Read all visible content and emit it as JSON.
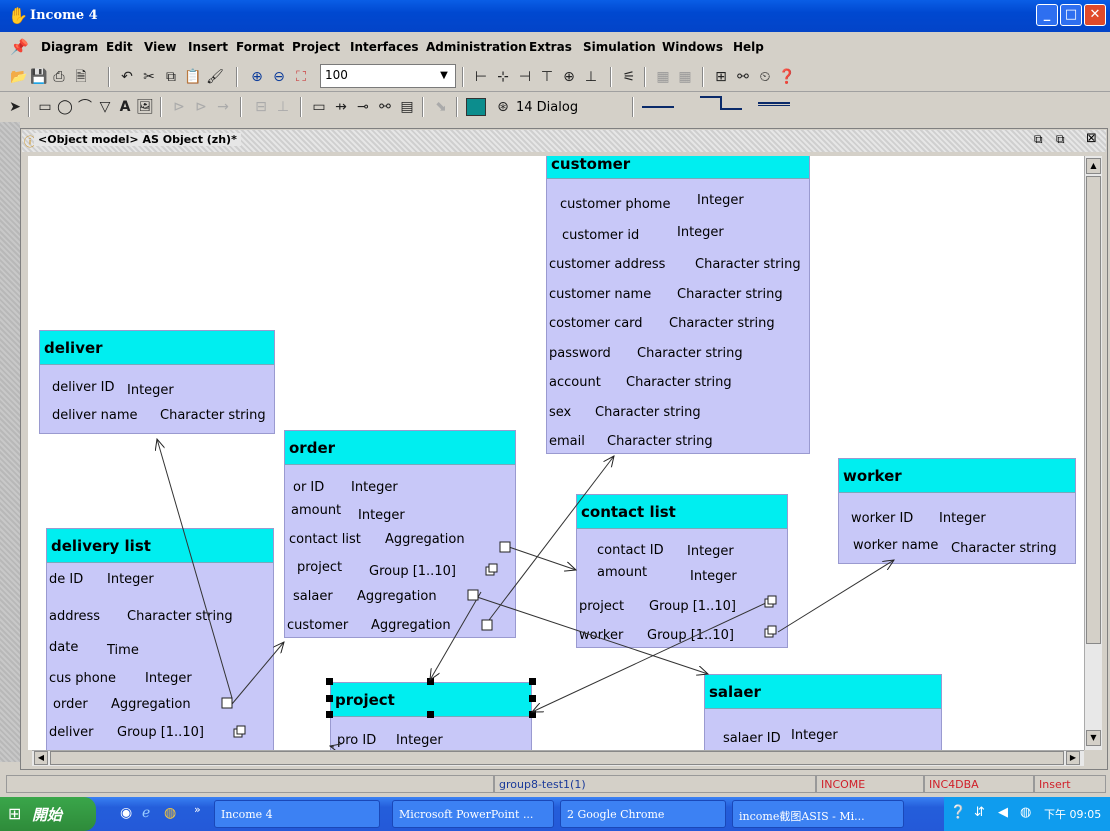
{
  "window": {
    "title": "Income 4"
  },
  "menu": [
    "Diagram",
    "Edit",
    "View",
    "Insert",
    "Format",
    "Project",
    "Interfaces",
    "Administration",
    "Extras",
    "Simulation",
    "Windows",
    "Help"
  ],
  "toolbar": {
    "zoom": "100",
    "dialog_label": "14 Dialog"
  },
  "inner": {
    "title": "<Object model> AS Object (zh)*"
  },
  "classes": {
    "customer": {
      "name": "customer",
      "attrs": [
        [
          "customer phome",
          "Integer"
        ],
        [
          "customer id",
          "Integer"
        ],
        [
          "customer address",
          "Character string"
        ],
        [
          "customer name",
          "Character string"
        ],
        [
          "costomer card",
          "Character string"
        ],
        [
          "password",
          "Character string"
        ],
        [
          "account",
          "Character string"
        ],
        [
          "sex",
          "Character string"
        ],
        [
          "email",
          "Character string"
        ]
      ]
    },
    "deliver": {
      "name": "deliver",
      "attrs": [
        [
          "deliver ID",
          "Integer"
        ],
        [
          "deliver name",
          "Character string"
        ]
      ]
    },
    "order": {
      "name": "order",
      "attrs": [
        [
          "or ID",
          "Integer"
        ],
        [
          "amount",
          "Integer"
        ],
        [
          "contact list",
          "Aggregation"
        ],
        [
          "project",
          "Group [1..10]"
        ],
        [
          "salaer",
          "Aggregation"
        ],
        [
          "customer",
          "Aggregation"
        ]
      ]
    },
    "worker": {
      "name": "worker",
      "attrs": [
        [
          "worker ID",
          "Integer"
        ],
        [
          "worker name",
          "Character string"
        ]
      ]
    },
    "contact_list": {
      "name": "contact list",
      "attrs": [
        [
          "contact ID",
          "Integer"
        ],
        [
          "amount",
          "Integer"
        ],
        [
          "project",
          "Group [1..10]"
        ],
        [
          "worker",
          "Group [1..10]"
        ]
      ]
    },
    "delivery_list": {
      "name": "delivery list",
      "attrs": [
        [
          "de ID",
          "Integer"
        ],
        [
          "address",
          "Character string"
        ],
        [
          "date",
          "Time"
        ],
        [
          "cus phone",
          "Integer"
        ],
        [
          "order",
          "Aggregation"
        ],
        [
          "deliver",
          "Group [1..10]"
        ]
      ]
    },
    "project": {
      "name": "project",
      "attrs": [
        [
          "pro ID",
          "Integer"
        ]
      ]
    },
    "salaer": {
      "name": "salaer",
      "attrs": [
        [
          "salaer ID",
          "Integer"
        ]
      ]
    }
  },
  "status": {
    "model": "group8-test1(1)",
    "db": "INCOME",
    "user": "INC4DBA",
    "mode": "Insert"
  },
  "taskbar": {
    "start": "開始",
    "items": [
      "Income 4",
      "Microsoft PowerPoint ...",
      "2 Google Chrome",
      "income截图ASIS - Mi..."
    ],
    "clock": "下午 09:05"
  }
}
